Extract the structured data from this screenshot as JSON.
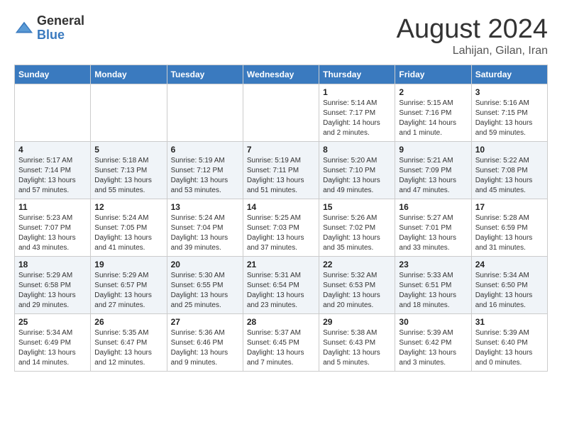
{
  "header": {
    "logo_general": "General",
    "logo_blue": "Blue",
    "title": "August 2024",
    "location": "Lahijan, Gilan, Iran"
  },
  "days_of_week": [
    "Sunday",
    "Monday",
    "Tuesday",
    "Wednesday",
    "Thursday",
    "Friday",
    "Saturday"
  ],
  "weeks": [
    [
      {
        "day": "",
        "info": ""
      },
      {
        "day": "",
        "info": ""
      },
      {
        "day": "",
        "info": ""
      },
      {
        "day": "",
        "info": ""
      },
      {
        "day": "1",
        "info": "Sunrise: 5:14 AM\nSunset: 7:17 PM\nDaylight: 14 hours\nand 2 minutes."
      },
      {
        "day": "2",
        "info": "Sunrise: 5:15 AM\nSunset: 7:16 PM\nDaylight: 14 hours\nand 1 minute."
      },
      {
        "day": "3",
        "info": "Sunrise: 5:16 AM\nSunset: 7:15 PM\nDaylight: 13 hours\nand 59 minutes."
      }
    ],
    [
      {
        "day": "4",
        "info": "Sunrise: 5:17 AM\nSunset: 7:14 PM\nDaylight: 13 hours\nand 57 minutes."
      },
      {
        "day": "5",
        "info": "Sunrise: 5:18 AM\nSunset: 7:13 PM\nDaylight: 13 hours\nand 55 minutes."
      },
      {
        "day": "6",
        "info": "Sunrise: 5:19 AM\nSunset: 7:12 PM\nDaylight: 13 hours\nand 53 minutes."
      },
      {
        "day": "7",
        "info": "Sunrise: 5:19 AM\nSunset: 7:11 PM\nDaylight: 13 hours\nand 51 minutes."
      },
      {
        "day": "8",
        "info": "Sunrise: 5:20 AM\nSunset: 7:10 PM\nDaylight: 13 hours\nand 49 minutes."
      },
      {
        "day": "9",
        "info": "Sunrise: 5:21 AM\nSunset: 7:09 PM\nDaylight: 13 hours\nand 47 minutes."
      },
      {
        "day": "10",
        "info": "Sunrise: 5:22 AM\nSunset: 7:08 PM\nDaylight: 13 hours\nand 45 minutes."
      }
    ],
    [
      {
        "day": "11",
        "info": "Sunrise: 5:23 AM\nSunset: 7:07 PM\nDaylight: 13 hours\nand 43 minutes."
      },
      {
        "day": "12",
        "info": "Sunrise: 5:24 AM\nSunset: 7:05 PM\nDaylight: 13 hours\nand 41 minutes."
      },
      {
        "day": "13",
        "info": "Sunrise: 5:24 AM\nSunset: 7:04 PM\nDaylight: 13 hours\nand 39 minutes."
      },
      {
        "day": "14",
        "info": "Sunrise: 5:25 AM\nSunset: 7:03 PM\nDaylight: 13 hours\nand 37 minutes."
      },
      {
        "day": "15",
        "info": "Sunrise: 5:26 AM\nSunset: 7:02 PM\nDaylight: 13 hours\nand 35 minutes."
      },
      {
        "day": "16",
        "info": "Sunrise: 5:27 AM\nSunset: 7:01 PM\nDaylight: 13 hours\nand 33 minutes."
      },
      {
        "day": "17",
        "info": "Sunrise: 5:28 AM\nSunset: 6:59 PM\nDaylight: 13 hours\nand 31 minutes."
      }
    ],
    [
      {
        "day": "18",
        "info": "Sunrise: 5:29 AM\nSunset: 6:58 PM\nDaylight: 13 hours\nand 29 minutes."
      },
      {
        "day": "19",
        "info": "Sunrise: 5:29 AM\nSunset: 6:57 PM\nDaylight: 13 hours\nand 27 minutes."
      },
      {
        "day": "20",
        "info": "Sunrise: 5:30 AM\nSunset: 6:55 PM\nDaylight: 13 hours\nand 25 minutes."
      },
      {
        "day": "21",
        "info": "Sunrise: 5:31 AM\nSunset: 6:54 PM\nDaylight: 13 hours\nand 23 minutes."
      },
      {
        "day": "22",
        "info": "Sunrise: 5:32 AM\nSunset: 6:53 PM\nDaylight: 13 hours\nand 20 minutes."
      },
      {
        "day": "23",
        "info": "Sunrise: 5:33 AM\nSunset: 6:51 PM\nDaylight: 13 hours\nand 18 minutes."
      },
      {
        "day": "24",
        "info": "Sunrise: 5:34 AM\nSunset: 6:50 PM\nDaylight: 13 hours\nand 16 minutes."
      }
    ],
    [
      {
        "day": "25",
        "info": "Sunrise: 5:34 AM\nSunset: 6:49 PM\nDaylight: 13 hours\nand 14 minutes."
      },
      {
        "day": "26",
        "info": "Sunrise: 5:35 AM\nSunset: 6:47 PM\nDaylight: 13 hours\nand 12 minutes."
      },
      {
        "day": "27",
        "info": "Sunrise: 5:36 AM\nSunset: 6:46 PM\nDaylight: 13 hours\nand 9 minutes."
      },
      {
        "day": "28",
        "info": "Sunrise: 5:37 AM\nSunset: 6:45 PM\nDaylight: 13 hours\nand 7 minutes."
      },
      {
        "day": "29",
        "info": "Sunrise: 5:38 AM\nSunset: 6:43 PM\nDaylight: 13 hours\nand 5 minutes."
      },
      {
        "day": "30",
        "info": "Sunrise: 5:39 AM\nSunset: 6:42 PM\nDaylight: 13 hours\nand 3 minutes."
      },
      {
        "day": "31",
        "info": "Sunrise: 5:39 AM\nSunset: 6:40 PM\nDaylight: 13 hours\nand 0 minutes."
      }
    ]
  ]
}
